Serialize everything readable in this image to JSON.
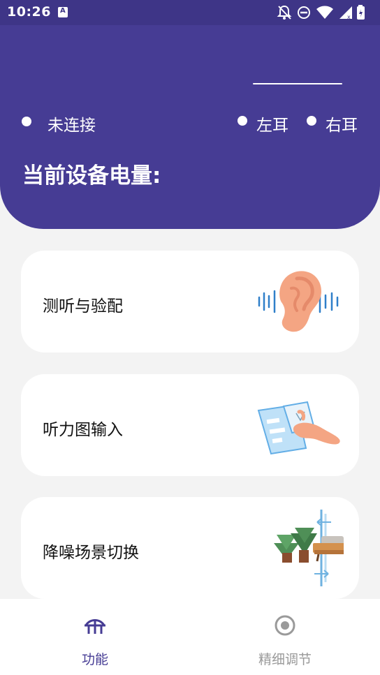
{
  "status_bar": {
    "time": "10:26",
    "icons": [
      "a-notification-icon",
      "mute-icon",
      "do-not-disturb-icon",
      "wifi-icon",
      "signal-icon",
      "battery-icon"
    ]
  },
  "header": {
    "connection_status": "未连接",
    "left_ear": "左耳",
    "right_ear": "右耳",
    "battery_title": "当前设备电量:"
  },
  "cards": [
    {
      "label": "测听与验配",
      "icon": "ear-icon"
    },
    {
      "label": "听力图输入",
      "icon": "hand-document-icon"
    },
    {
      "label": "降噪场景切换",
      "icon": "scene-switch-icon"
    }
  ],
  "bottom_nav": {
    "items": [
      {
        "label": "功能",
        "icon": "function-icon",
        "active": true
      },
      {
        "label": "精细调节",
        "icon": "fine-tune-icon",
        "active": false
      }
    ]
  },
  "colors": {
    "header": "#463c94",
    "status_bar": "#3e3587",
    "nav_active": "#463c94",
    "nav_inactive": "#999999",
    "background": "#f3f3f3"
  }
}
